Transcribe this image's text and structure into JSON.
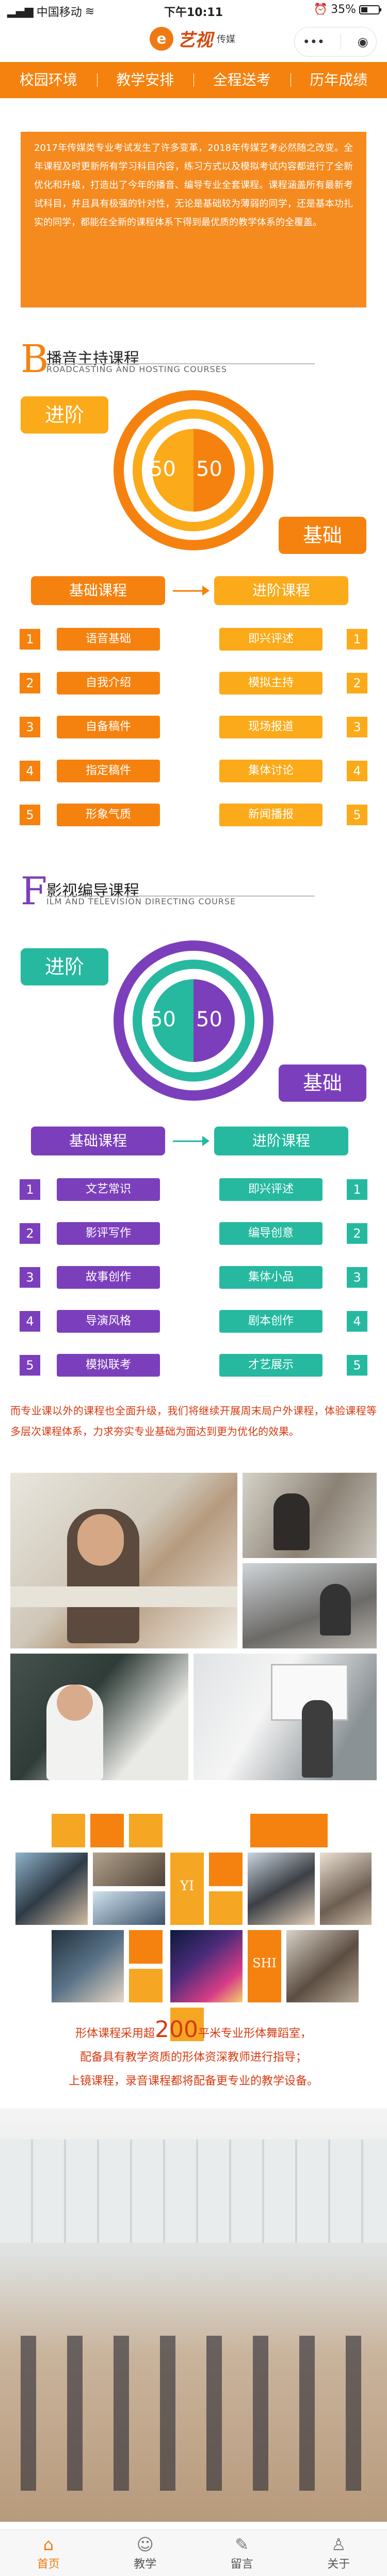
{
  "status": {
    "carrier": "中国移动",
    "time": "下午10:11",
    "battery": "35%"
  },
  "header": {
    "logo_mark": "e",
    "logo_name": "艺视",
    "logo_sub": "传媒",
    "menu_icon": "•••",
    "record_icon": "◉"
  },
  "nav": [
    "校园环境",
    "教学安排",
    "全程送考",
    "历年成绩"
  ],
  "intro": "2017年传媒类专业考试发生了许多变革，2018年传媒艺考必然随之改变。全年课程及时更新所有学习科目内容，练习方式以及模拟考试内容都进行了全新优化和升级，打造出了今年的播音、编导专业全套课程。课程涵盖所有最新考试科目，并且具有极强的针对性，无论是基础较为薄弱的同学，还是基本功扎实的同学，都能在全新的课程体系下得到最优质的教学体系的全覆盖。",
  "sec1": {
    "big": "B",
    "title": "播音主持课程",
    "sub": "ROADCASTING AND HOSTING COURSES",
    "adv": "进阶",
    "base": "基础",
    "pct_left": "50",
    "pct_right": "50",
    "basic_header": "基础课程",
    "adv_header": "进阶课程",
    "basic": [
      "语音基础",
      "自我介绍",
      "自备稿件",
      "指定稿件",
      "形象气质"
    ],
    "advanced": [
      "即兴评述",
      "模拟主持",
      "现场报道",
      "集体讨论",
      "新闻播报"
    ],
    "colors": {
      "main": "#f5820f",
      "accent": "#fbaa19"
    }
  },
  "sec2": {
    "big": "F",
    "title": "影视编导课程",
    "sub": "ILM AND TELEVISION DIRECTING COURSE",
    "adv": "进阶",
    "base": "基础",
    "pct_left": "50",
    "pct_right": "50",
    "basic_header": "基础课程",
    "adv_header": "进阶课程",
    "basic": [
      "文艺常识",
      "影评写作",
      "故事创作",
      "导演风格",
      "模拟联考"
    ],
    "advanced": [
      "即兴评述",
      "编导创意",
      "集体小品",
      "剧本创作",
      "才艺展示"
    ],
    "colors": {
      "main": "#7b3fbc",
      "accent": "#26b9a0"
    }
  },
  "numbers": [
    "1",
    "2",
    "3",
    "4",
    "5"
  ],
  "note": "而专业课以外的课程也全面升级，我们将继续开展周末局户外课程，体验课程等多层次课程体系，力求夯实专业基础为面达到更为优化的效果。",
  "tiles": {
    "yi": "YI",
    "shi": "SHI"
  },
  "body_text": {
    "line1_pre": "形体课程采用超",
    "line1_big": "200",
    "line1_post": "平米专业形体舞蹈室，",
    "line2": "配备具有教学资质的形体资深教师进行指导；",
    "line3": "上镜课程，录音课程都将配备更专业的教学设备。"
  },
  "tabbar": [
    {
      "label": "首页",
      "icon": "home-icon",
      "glyph": "⌂"
    },
    {
      "label": "教学",
      "icon": "person-icon",
      "glyph": "☺"
    },
    {
      "label": "留言",
      "icon": "edit-icon",
      "glyph": "✎"
    },
    {
      "label": "关于",
      "icon": "user-icon",
      "glyph": "♙"
    }
  ]
}
